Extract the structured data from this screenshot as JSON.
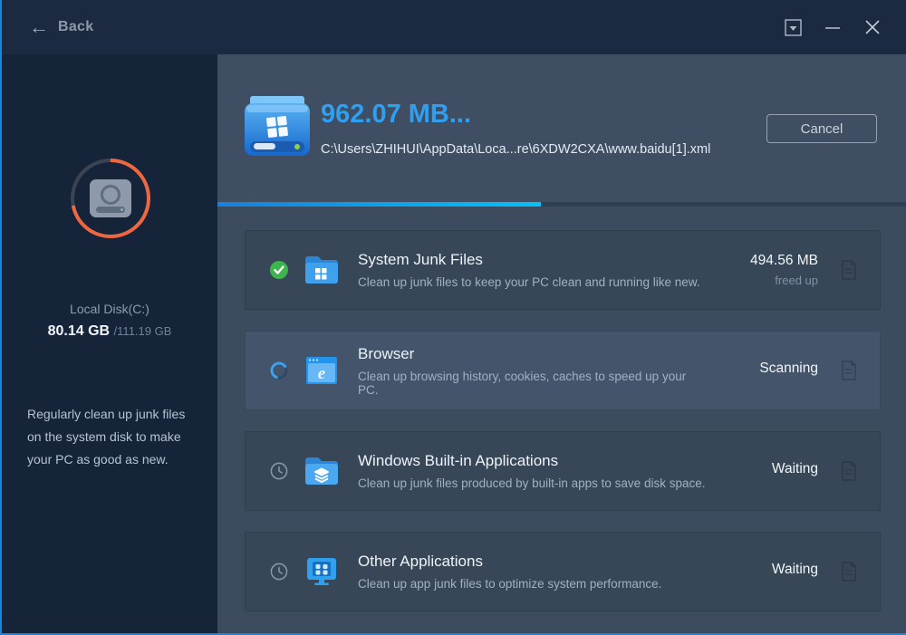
{
  "titlebar": {
    "back_label": "Back",
    "icons": [
      "back-arrow-icon",
      "window-menu-icon",
      "minimize-icon",
      "close-icon"
    ]
  },
  "sidebar": {
    "disk_name": "Local Disk(C:)",
    "disk_used": "80.14 GB",
    "disk_total": "/111.19 GB",
    "usage_percent": 72,
    "ring_color": "#ed6742",
    "ring_track_color": "#3b4453",
    "description": "Regularly clean up junk files on the system disk to make your PC as good as new."
  },
  "header": {
    "freed_size": "962.07 MB...",
    "scanning_path": "C:\\Users\\ZHIHUI\\AppData\\Loca...re\\6XDW2CXA\\www.baidu[1].xml",
    "cancel_label": "Cancel",
    "progress_percent": 47,
    "accent_color": "#2f9ff0",
    "progress_gradient": [
      "#1a7fd9",
      "#04c1f7"
    ]
  },
  "tasks": [
    {
      "title": "System Junk Files",
      "description": "Clean up junk files to keep your PC clean and running like new.",
      "status": "done",
      "status_icon": "check-circle-icon",
      "app_icon": "windows-folder-icon",
      "value": "494.56 MB",
      "value_sub": "freed up"
    },
    {
      "title": "Browser",
      "description": "Clean up browsing history, cookies, caches to speed up your PC.",
      "status": "scanning",
      "status_icon": "spinner-icon",
      "app_icon": "browser-icon",
      "value": "Scanning",
      "value_sub": ""
    },
    {
      "title": "Windows Built-in Applications",
      "description": "Clean up junk files produced by built-in apps to save disk space.",
      "status": "waiting",
      "status_icon": "clock-icon",
      "app_icon": "layers-folder-icon",
      "value": "Waiting",
      "value_sub": ""
    },
    {
      "title": "Other Applications",
      "description": "Clean up app junk files to optimize system performance.",
      "status": "waiting",
      "status_icon": "clock-icon",
      "app_icon": "apps-monitor-icon",
      "value": "Waiting",
      "value_sub": ""
    }
  ]
}
